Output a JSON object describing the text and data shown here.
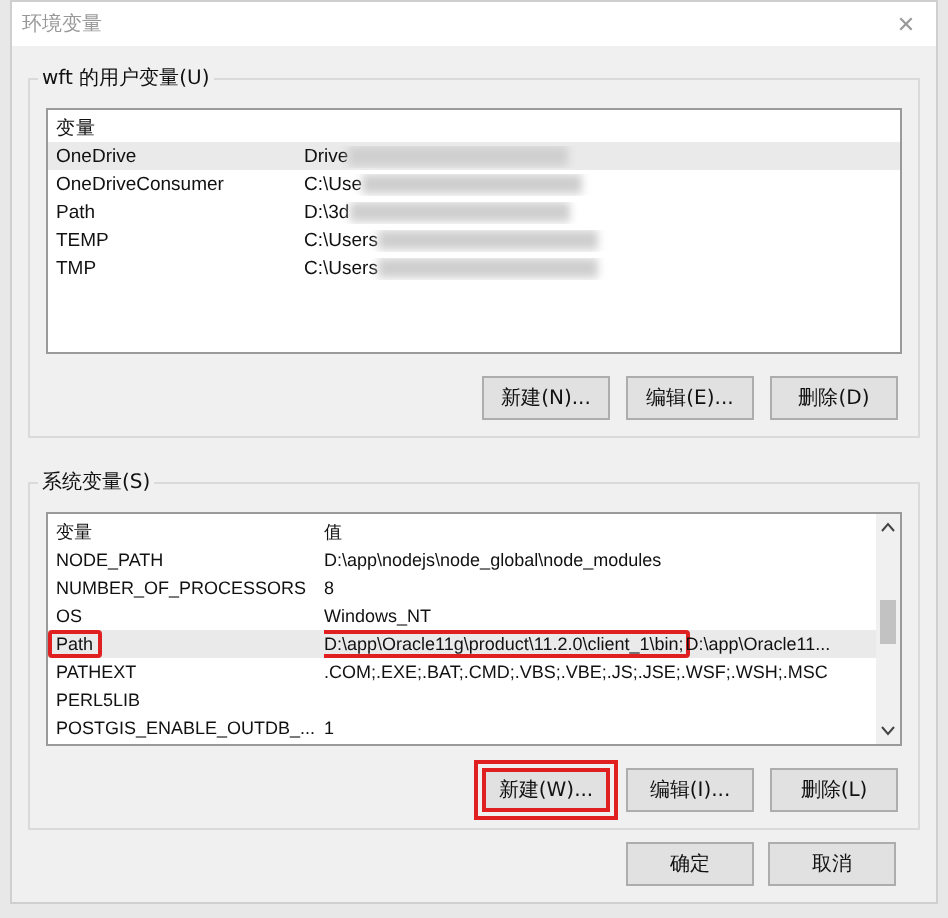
{
  "window": {
    "title": "环境变量",
    "close": "✕"
  },
  "user_vars": {
    "label": "wft 的用户变量(U)",
    "columns": [
      "变量",
      ""
    ],
    "rows": [
      {
        "name": "OneDrive",
        "value": "Drive",
        "redacted": true,
        "selected": true
      },
      {
        "name": "OneDriveConsumer",
        "value": "C:\\Use",
        "redacted": true,
        "selected": false
      },
      {
        "name": "Path",
        "value": "D:\\3d",
        "redacted": true,
        "selected": false
      },
      {
        "name": "TEMP",
        "value": "C:\\Users",
        "redacted": true,
        "selected": false
      },
      {
        "name": "TMP",
        "value": "C:\\Users",
        "redacted": true,
        "selected": false
      }
    ],
    "buttons": [
      {
        "label": "新建(N)...",
        "highlighted": false
      },
      {
        "label": "编辑(E)...",
        "highlighted": false
      },
      {
        "label": "删除(D)",
        "highlighted": false
      }
    ]
  },
  "system_vars": {
    "label": "系统变量(S)",
    "columns": [
      "变量",
      "值"
    ],
    "rows": [
      {
        "name": "NODE_PATH",
        "selected": false,
        "highlighted": false,
        "value_parts": [
          {
            "text": "D:\\app\\nodejs\\node_global\\node_modules",
            "highlighted": false
          }
        ]
      },
      {
        "name": "NUMBER_OF_PROCESSORS",
        "selected": false,
        "highlighted": false,
        "value_parts": [
          {
            "text": "8",
            "highlighted": false
          }
        ]
      },
      {
        "name": "OS",
        "selected": false,
        "highlighted": false,
        "value_parts": [
          {
            "text": "Windows_NT",
            "highlighted": false
          }
        ]
      },
      {
        "name": "Path",
        "selected": true,
        "highlighted": true,
        "value_parts": [
          {
            "text": "D:\\app\\Oracle11g\\product\\11.2.0\\client_1\\bin;",
            "highlighted": true
          },
          {
            "text": "D:\\app\\Oracle11...",
            "highlighted": false
          }
        ]
      },
      {
        "name": "PATHEXT",
        "selected": false,
        "highlighted": false,
        "value_parts": [
          {
            "text": ".COM;.EXE;.BAT;.CMD;.VBS;.VBE;.JS;.JSE;.WSF;.WSH;.MSC",
            "highlighted": false
          }
        ]
      },
      {
        "name": "PERL5LIB",
        "selected": false,
        "highlighted": false,
        "value_parts": []
      },
      {
        "name": "POSTGIS_ENABLE_OUTDB_...",
        "selected": false,
        "highlighted": false,
        "value_parts": [
          {
            "text": "1",
            "highlighted": false
          }
        ]
      }
    ],
    "buttons": [
      {
        "label": "新建(W)...",
        "highlighted": true
      },
      {
        "label": "编辑(I)...",
        "highlighted": false
      },
      {
        "label": "删除(L)",
        "highlighted": false
      }
    ]
  },
  "footer_buttons": [
    {
      "label": "确定"
    },
    {
      "label": "取消"
    }
  ]
}
